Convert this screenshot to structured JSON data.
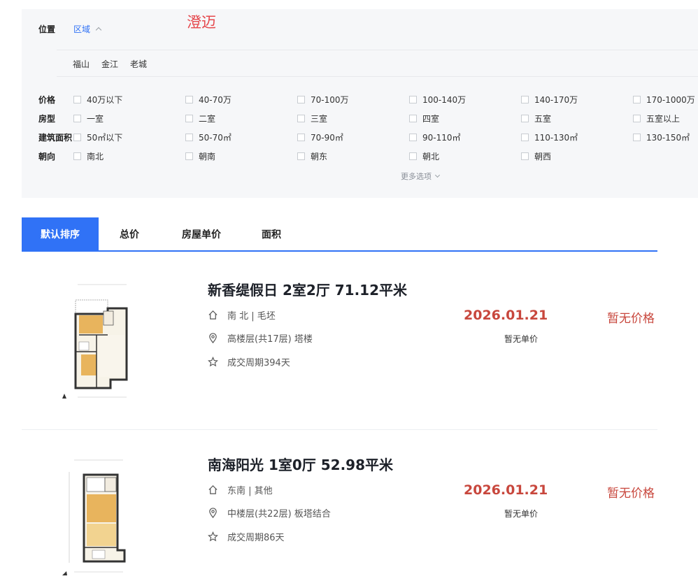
{
  "filters": {
    "region_name": "澄迈",
    "location_label": "位置",
    "region_toggle": "区域",
    "areas": [
      "福山",
      "金江",
      "老城"
    ],
    "price": {
      "label": "价格",
      "options": [
        "40万以下",
        "40-70万",
        "70-100万",
        "100-140万",
        "140-170万",
        "170-1000万"
      ]
    },
    "layout": {
      "label": "房型",
      "options": [
        "一室",
        "二室",
        "三室",
        "四室",
        "五室",
        "五室以上"
      ]
    },
    "area": {
      "label": "建筑面积",
      "options": [
        "50㎡以下",
        "50-70㎡",
        "70-90㎡",
        "90-110㎡",
        "110-130㎡",
        "130-150㎡"
      ]
    },
    "orientation": {
      "label": "朝向",
      "options": [
        "南北",
        "朝南",
        "朝东",
        "朝北",
        "朝西"
      ]
    },
    "more_label": "更多选项"
  },
  "sort_tabs": [
    "默认排序",
    "总价",
    "房屋单价",
    "面积"
  ],
  "listings": [
    {
      "title": "新香缇假日 2室2厅 71.12平米",
      "orientation_decor": "南 北 | 毛坯",
      "floor": "高楼层(共17层) 塔楼",
      "cycle": "成交周期394天",
      "deal_date": "2026.01.21",
      "unit_price": "暂无单价",
      "total_price": "暂无价格"
    },
    {
      "title": "南海阳光 1室0厅 52.98平米",
      "orientation_decor": "东南 | 其他",
      "floor": "中楼层(共22层) 板塔结合",
      "cycle": "成交周期86天",
      "deal_date": "2026.01.21",
      "unit_price": "暂无单价",
      "total_price": "暂无价格"
    }
  ],
  "colors": {
    "accent": "#3072f6",
    "price": "#c8473d",
    "region": "#e5484d"
  }
}
